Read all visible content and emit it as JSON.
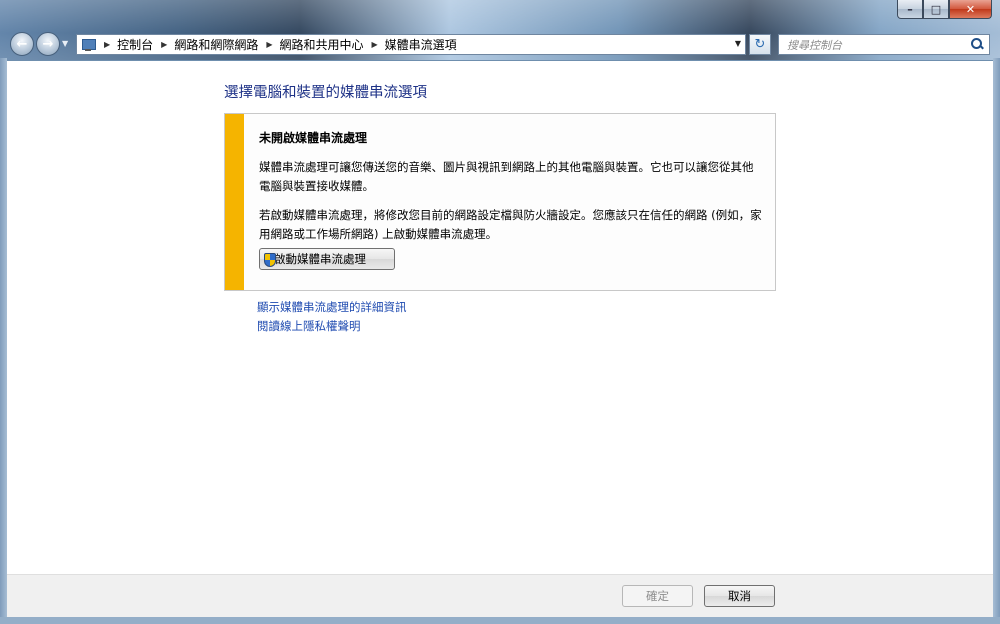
{
  "breadcrumb": {
    "items": [
      "控制台",
      "網路和網際網路",
      "網路和共用中心",
      "媒體串流選項"
    ]
  },
  "search": {
    "placeholder": "搜尋控制台"
  },
  "page": {
    "title": "選擇電腦和裝置的媒體串流選項"
  },
  "info_box": {
    "heading": "未開啟媒體串流處理",
    "paragraph1": "媒體串流處理可讓您傳送您的音樂、圖片與視訊到網路上的其他電腦與裝置。它也可以讓您從其他電腦與裝置接收媒體。",
    "paragraph2": "若啟動媒體串流處理，將修改您目前的網路設定檔與防火牆設定。您應該只在信任的網路 (例如，家用網路或工作場所網路) 上啟動媒體串流處理。",
    "button_label": "啟動媒體串流處理",
    "accent_color": "#f5b400"
  },
  "links": {
    "details": "顯示媒體串流處理的詳細資訊",
    "privacy": "閱讀線上隱私權聲明"
  },
  "footer": {
    "ok_label": "確定",
    "cancel_label": "取消"
  },
  "icons": {
    "back": "back-arrow-icon",
    "forward": "forward-arrow-icon",
    "refresh": "refresh-icon",
    "search": "search-icon",
    "shield": "uac-shield-icon"
  }
}
